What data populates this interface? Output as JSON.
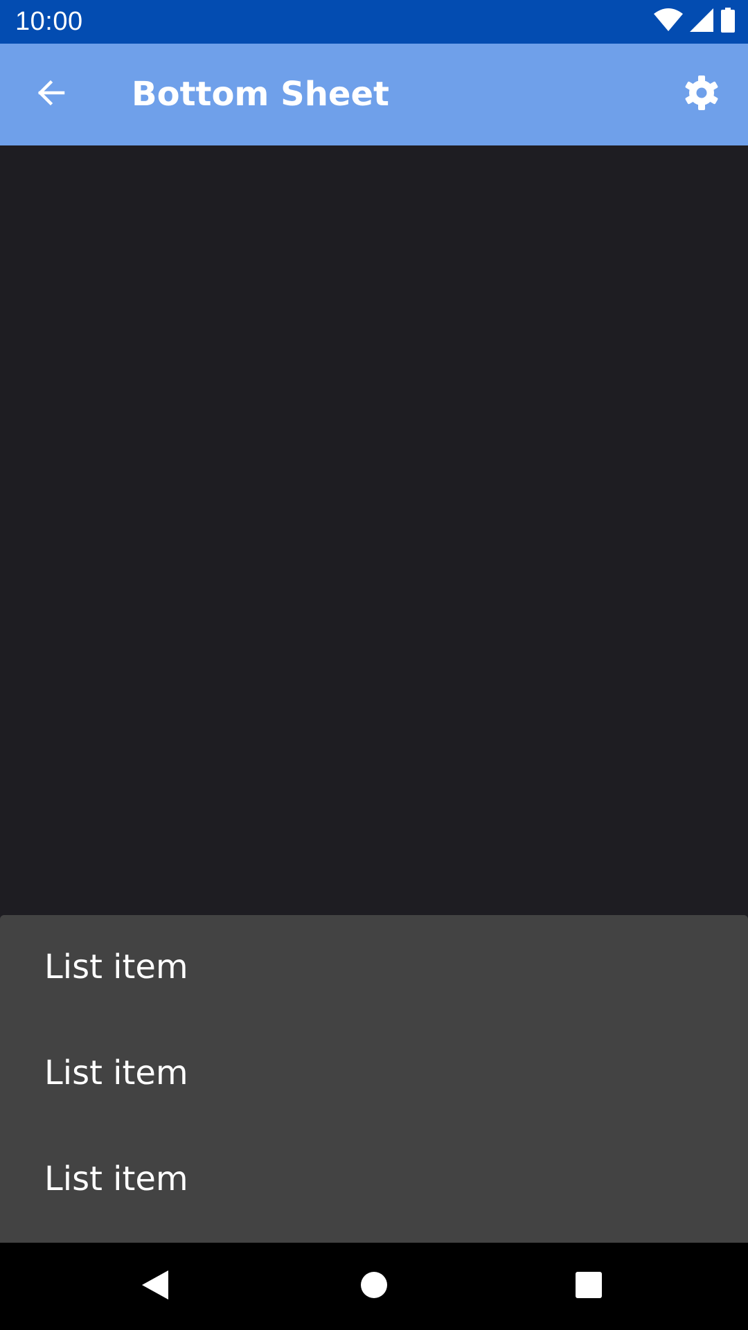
{
  "status_bar": {
    "time": "10:00",
    "icons": [
      "wifi-icon",
      "cellular-signal-icon",
      "battery-icon"
    ],
    "background": "#034cb1"
  },
  "app_bar": {
    "title": "Bottom Sheet",
    "back_icon": "arrow-back-icon",
    "settings_icon": "gear-icon",
    "background": "#6fa0ea"
  },
  "content": {
    "background": "#1e1d22"
  },
  "bottom_sheet": {
    "background": "#434343",
    "items": [
      {
        "label": "List item"
      },
      {
        "label": "List item"
      },
      {
        "label": "List item"
      }
    ]
  },
  "nav_bar": {
    "buttons": [
      "nav-back-icon",
      "nav-home-icon",
      "nav-recents-icon"
    ],
    "background": "#000000"
  }
}
